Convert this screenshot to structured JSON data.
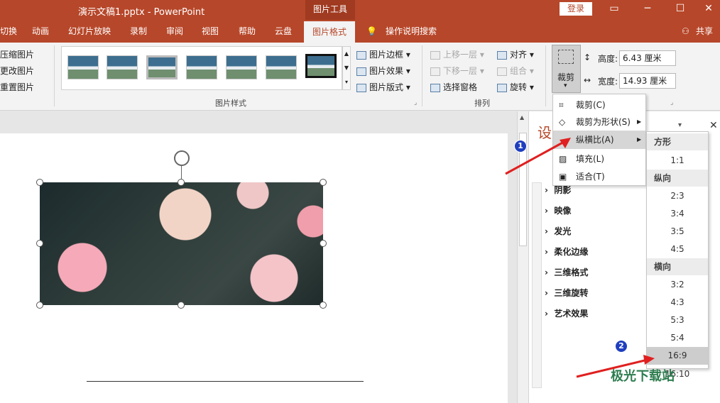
{
  "titlebar": {
    "title": "演示文稿1.pptx  -  PowerPoint",
    "picture_tools": "图片工具",
    "login": "登录",
    "minimize": "─",
    "restore": "☐",
    "close": "✕"
  },
  "tabs": [
    "切换",
    "动画",
    "幻灯片放映",
    "录制",
    "审阅",
    "视图",
    "帮助",
    "云盘",
    "图片格式"
  ],
  "tell_me": "操作说明搜索",
  "share": "共享",
  "adjust": [
    "压缩图片",
    "更改图片",
    "重置图片"
  ],
  "picture_styles": {
    "label": "图片样式",
    "border": "图片边框",
    "effects": "图片效果",
    "layout": "图片版式"
  },
  "arrange": {
    "label": "排列",
    "bring_forward": "上移一层",
    "send_backward": "下移一层",
    "selection_pane": "选择窗格",
    "align": "对齐",
    "group": "组合",
    "rotate": "旋转"
  },
  "size": {
    "crop": "裁剪",
    "height_label": "高度:",
    "height_value": "6.43 厘米",
    "width_label": "宽度:",
    "width_value": "14.93 厘米"
  },
  "crop_menu": {
    "crop": "裁剪(C)",
    "crop_to_shape": "裁剪为形状(S)",
    "aspect_ratio": "纵横比(A)",
    "fill": "填充(L)",
    "fit": "适合(T)"
  },
  "aspect_menu": {
    "square": "方形",
    "r11": "1:1",
    "portrait": "纵向",
    "r23": "2:3",
    "r34": "3:4",
    "r35": "3:5",
    "r45": "4:5",
    "landscape": "横向",
    "r32": "3:2",
    "r43": "4:3",
    "r53": "5:3",
    "r54": "5:4",
    "r169": "16:9",
    "r1610": "16:10"
  },
  "pane": {
    "title": "设",
    "items": [
      "阴影",
      "映像",
      "发光",
      "柔化边缘",
      "三维格式",
      "三维旋转",
      "艺术效果"
    ]
  },
  "badges": [
    "1",
    "2"
  ],
  "watermark": "极光下载站"
}
